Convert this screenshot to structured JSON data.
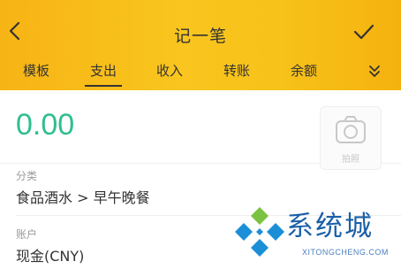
{
  "header": {
    "title": "记一笔",
    "status_partial_left": "",
    "status_partial_mid": ""
  },
  "tabs": [
    {
      "label": "模板"
    },
    {
      "label": "支出",
      "active": true
    },
    {
      "label": "收入"
    },
    {
      "label": "转账"
    },
    {
      "label": "余额"
    }
  ],
  "amount": {
    "value": "0.00",
    "color": "#2fbf8e"
  },
  "camera": {
    "label": "拍照"
  },
  "category": {
    "label": "分类",
    "value": "食品酒水 > 早午晚餐"
  },
  "account": {
    "label": "账户",
    "value": "现金(CNY)"
  },
  "watermark": {
    "text": "系统城",
    "sub": "XITONGCHENG.COM"
  },
  "colors": {
    "header": "#f9c51e",
    "accent_green": "#2fbf8e",
    "watermark_blue": "#1a5fa8"
  }
}
